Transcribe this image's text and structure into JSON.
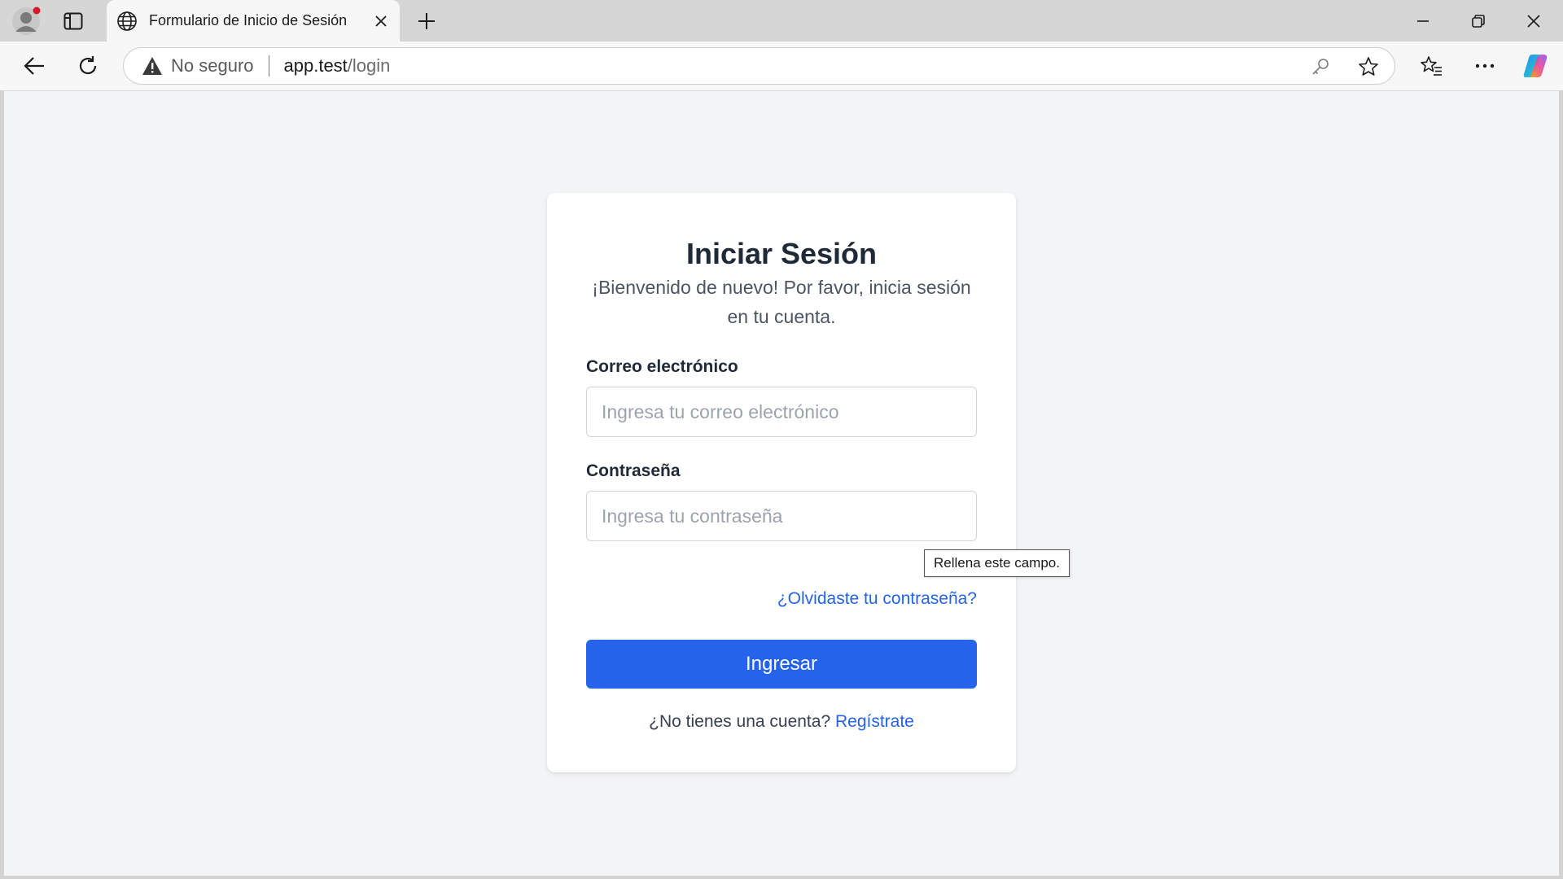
{
  "browser": {
    "tab_title": "Formulario de Inicio de Sesión",
    "security_label": "No seguro",
    "url_host": "app.test",
    "url_path": "/login"
  },
  "login": {
    "title": "Iniciar Sesión",
    "subtitle": "¡Bienvenido de nuevo! Por favor, inicia sesión en tu cuenta.",
    "email_label": "Correo electrónico",
    "email_placeholder": "Ingresa tu correo electrónico",
    "email_value": "",
    "password_label": "Contraseña",
    "password_placeholder": "Ingresa tu contraseña",
    "password_value": "",
    "forgot_link": "¿Olvidaste tu contraseña?",
    "submit_label": "Ingresar",
    "signup_prompt": "¿No tienes una cuenta?",
    "signup_link": "Regístrate"
  },
  "validation_tooltip": "Rellena este campo.",
  "colors": {
    "accent": "#2563eb",
    "page_background": "#f3f4f6",
    "card_background": "#ffffff"
  },
  "icons": [
    "profile-icon",
    "tab-actions-icon",
    "globe-icon",
    "close-icon",
    "plus-icon",
    "minimize-icon",
    "restore-icon",
    "window-close-icon",
    "back-icon",
    "refresh-icon",
    "warning-icon",
    "key-icon",
    "star-icon",
    "favorites-icon",
    "more-icon",
    "copilot-icon"
  ]
}
